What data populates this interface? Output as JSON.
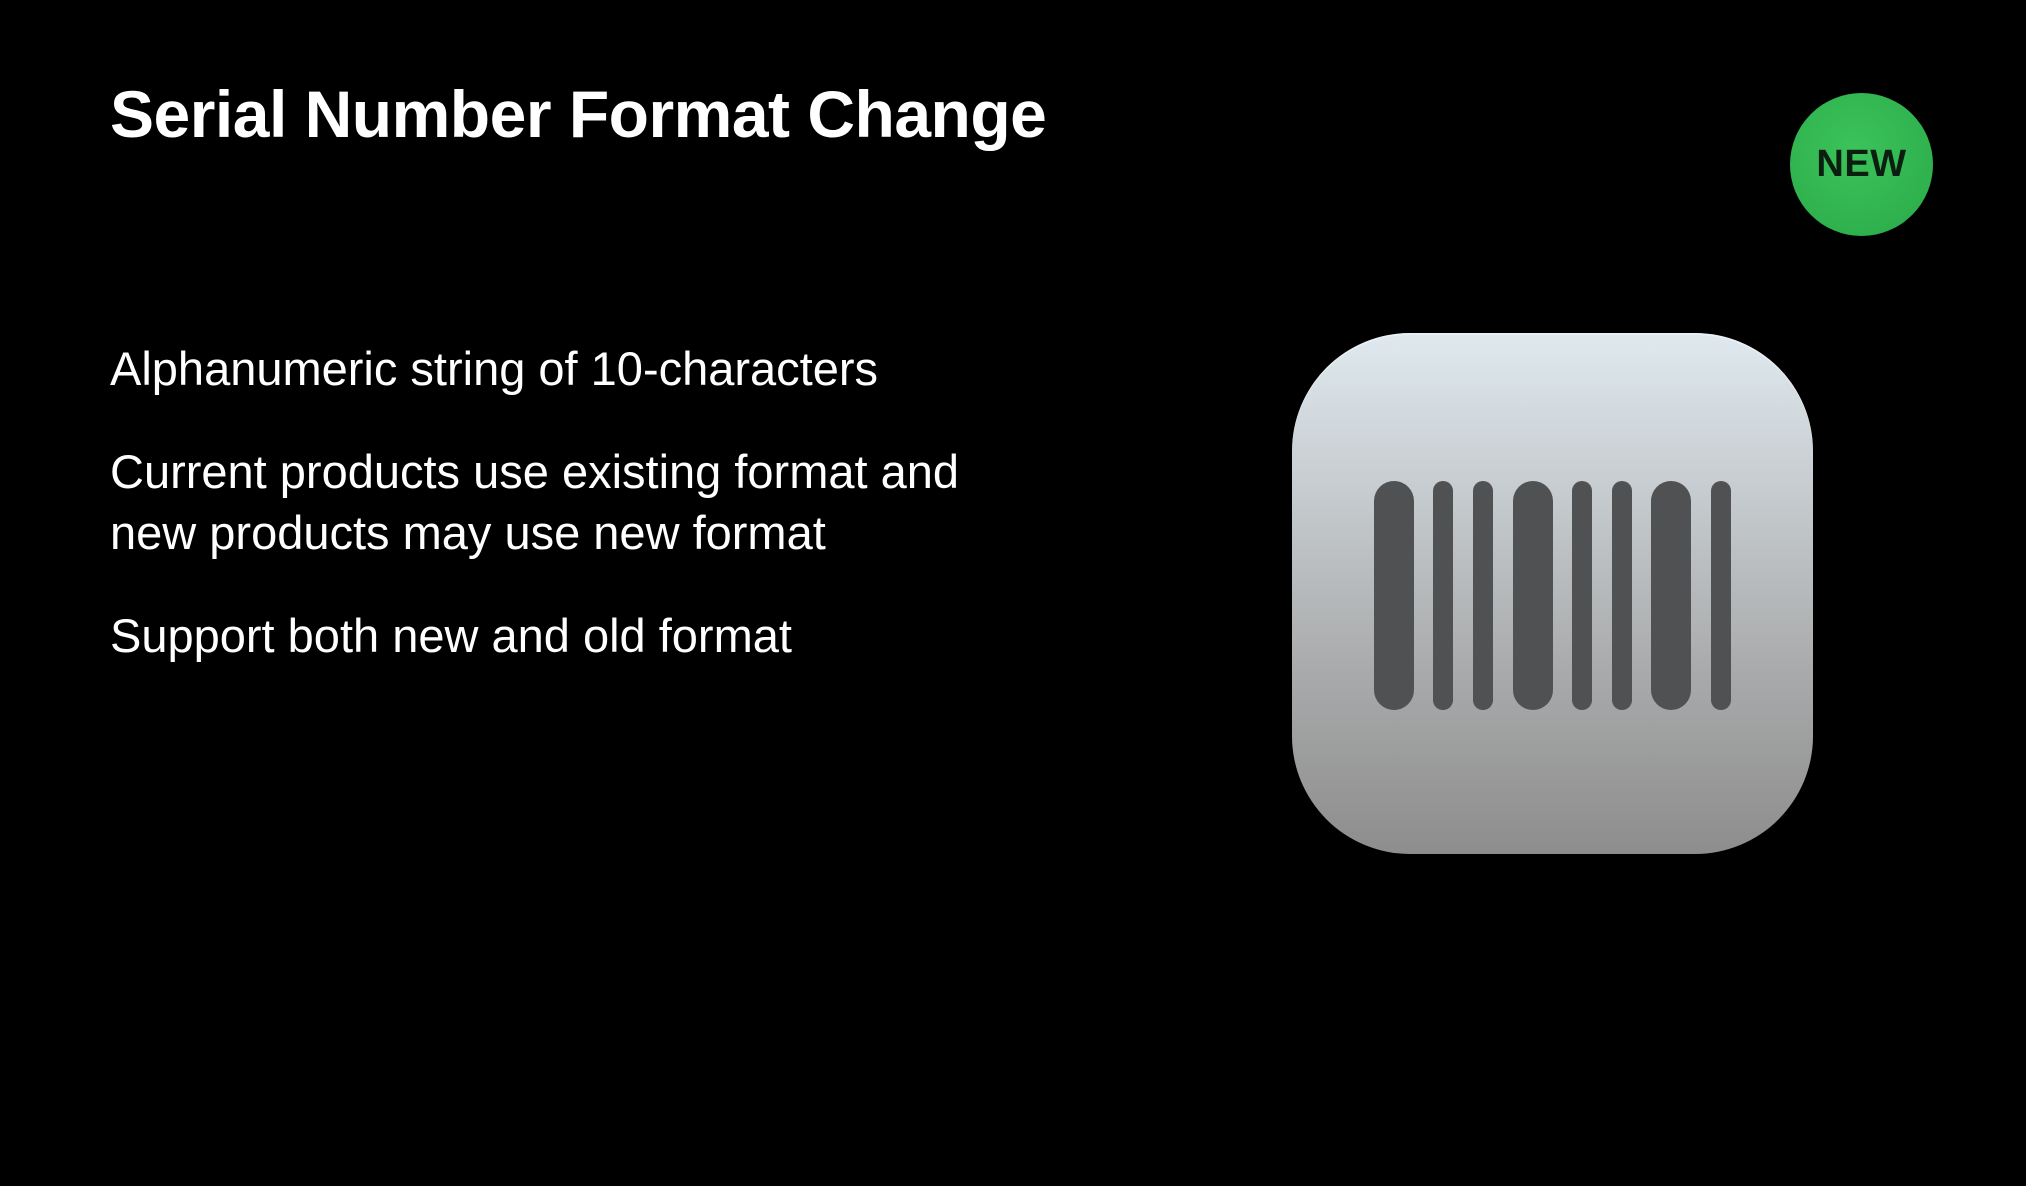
{
  "slide": {
    "title": "Serial Number Format Change",
    "badge": {
      "label": "NEW",
      "color": "#30b14f"
    },
    "bullets": [
      "Alphanumeric string of 10-characters",
      "Current products use existing format and new products may use new format",
      "Support both new and old format"
    ],
    "icon": {
      "name": "barcode-icon",
      "bar_color": "#4f5152"
    }
  }
}
